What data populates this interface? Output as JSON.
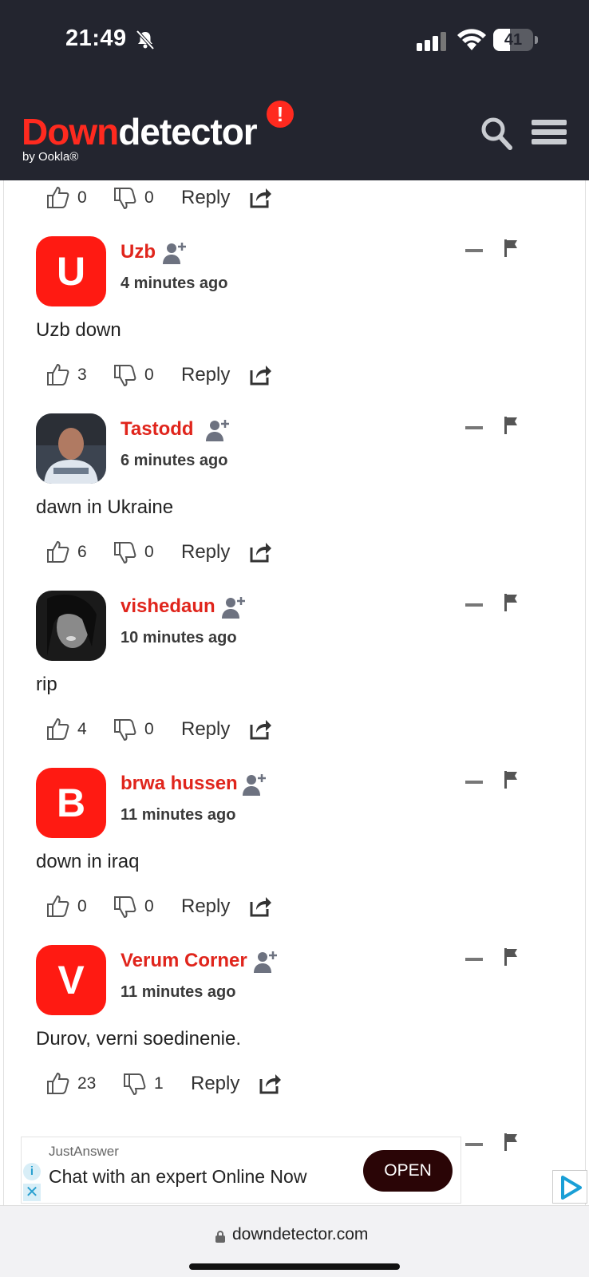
{
  "status": {
    "time": "21:49",
    "battery": "41",
    "battery_level": 0.41
  },
  "header": {
    "logo_down": "Down",
    "logo_detector": "detector",
    "logo_bang": "!",
    "byline": "by Ookla®"
  },
  "top_actions": {
    "likes": "0",
    "dislikes": "0",
    "reply": "Reply"
  },
  "comments": [
    {
      "avatar_letter": "U",
      "name": "Uzb",
      "time": "4 minutes ago",
      "text": "Uzb down",
      "likes": "3",
      "dislikes": "0",
      "reply": "Reply"
    },
    {
      "avatar_letter": "",
      "name": "Tastodd",
      "time": "6 minutes ago",
      "text": "dawn in Ukraine",
      "likes": "6",
      "dislikes": "0",
      "reply": "Reply"
    },
    {
      "avatar_letter": "",
      "name": "vishedaun",
      "time": "10 minutes ago",
      "text": "rip",
      "likes": "4",
      "dislikes": "0",
      "reply": "Reply"
    },
    {
      "avatar_letter": "B",
      "name": "brwa hussen",
      "time": "11 minutes ago",
      "text": "down in iraq",
      "likes": "0",
      "dislikes": "0",
      "reply": "Reply"
    },
    {
      "avatar_letter": "V",
      "name": "Verum Corner",
      "time": "11 minutes ago",
      "text": "Durov, verni soedinenie.",
      "likes": "23",
      "dislikes": "1",
      "reply": "Reply"
    }
  ],
  "ad": {
    "brand": "JustAnswer",
    "title": "Chat with an expert Online Now",
    "cta": "OPEN",
    "info": "i",
    "close": "✕"
  },
  "browser": {
    "url": "downdetector.com"
  },
  "colors": {
    "brand_red": "#ff2a1f",
    "header_bg": "#23252f",
    "username_red": "#e0251c",
    "ad_button": "#2a0506"
  }
}
